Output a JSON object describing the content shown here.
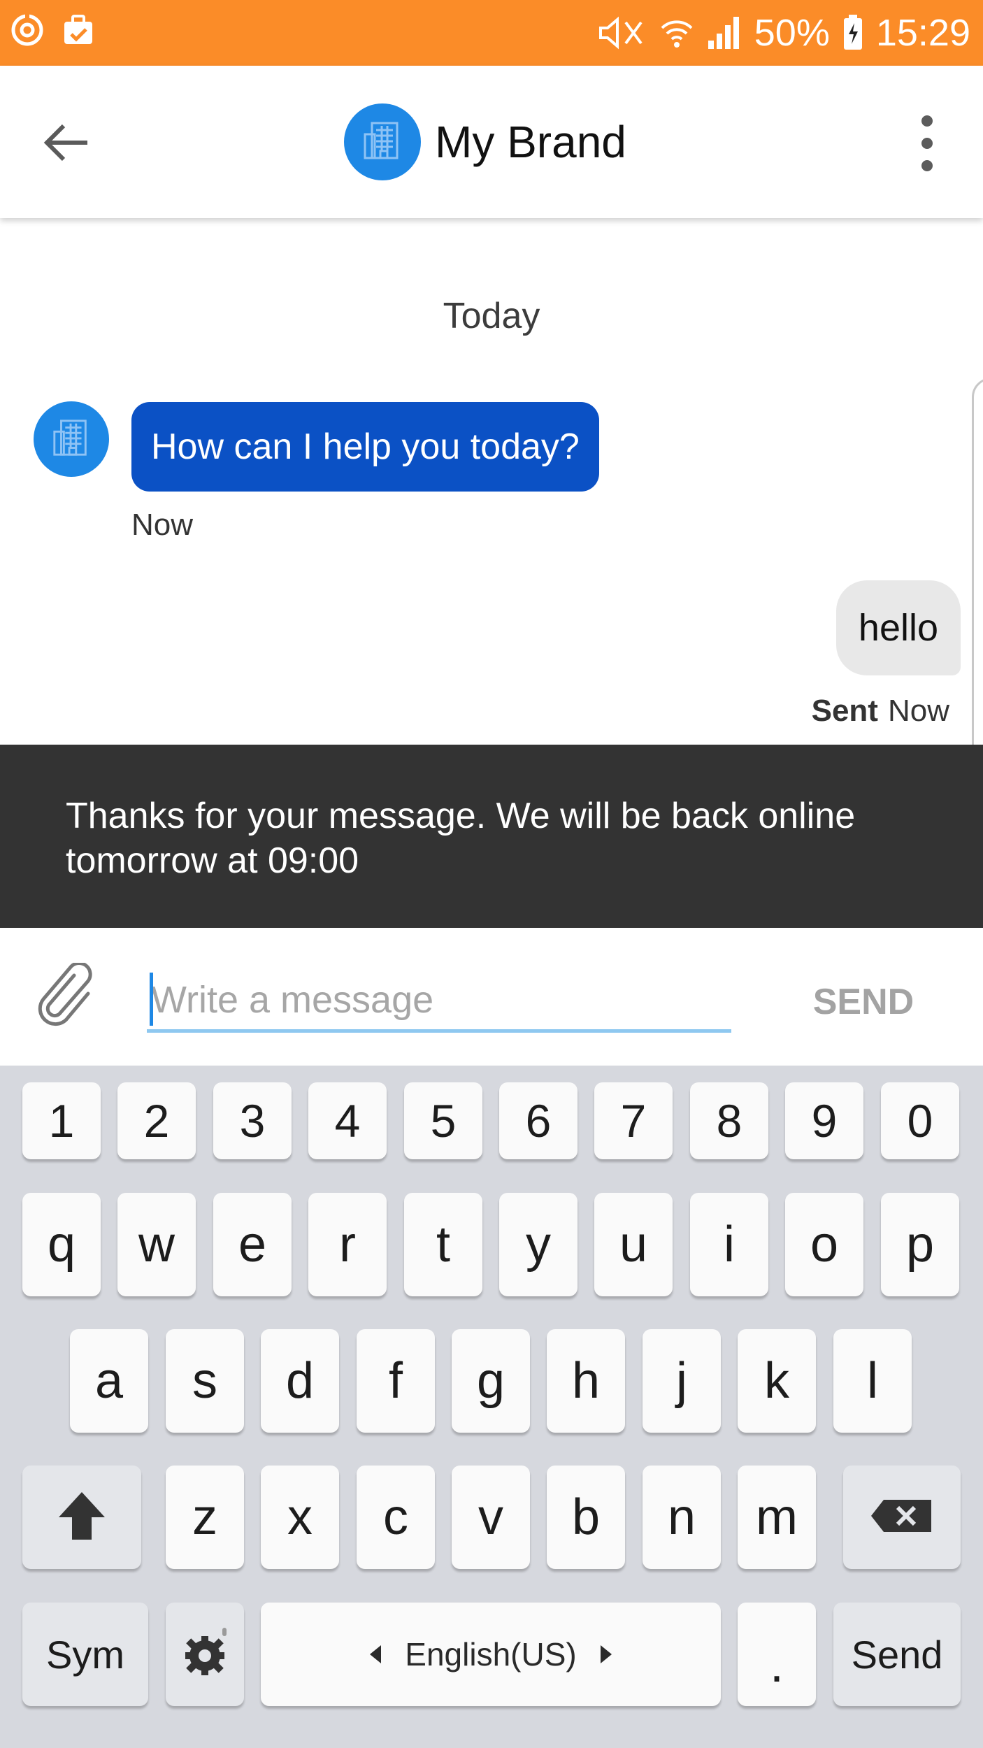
{
  "status_bar": {
    "battery": "50%",
    "time": "15:29",
    "icons": [
      "sync-icon",
      "clipboard-icon",
      "mute-icon",
      "wifi-icon",
      "signal-icon",
      "battery-charging-icon"
    ]
  },
  "header": {
    "title": "My Brand",
    "back_icon": "arrow-back-icon",
    "menu_icon": "more-vertical-icon",
    "avatar_icon": "building-icon"
  },
  "conversation": {
    "date_separator": "Today",
    "messages": [
      {
        "direction": "incoming",
        "text": "How can I help you today?",
        "time": "Now"
      },
      {
        "direction": "outgoing",
        "text": "hello",
        "status": "Sent",
        "time": "Now"
      }
    ]
  },
  "banner": {
    "text": "Thanks for your message. We will be back online tomorrow at 09:00"
  },
  "composer": {
    "placeholder": "Write a message",
    "value": "",
    "send_label": "SEND",
    "attach_icon": "paperclip-icon"
  },
  "keyboard": {
    "number_row": [
      "1",
      "2",
      "3",
      "4",
      "5",
      "6",
      "7",
      "8",
      "9",
      "0"
    ],
    "row1": [
      "q",
      "w",
      "e",
      "r",
      "t",
      "y",
      "u",
      "i",
      "o",
      "p"
    ],
    "row2": [
      "a",
      "s",
      "d",
      "f",
      "g",
      "h",
      "j",
      "k",
      "l"
    ],
    "row3": [
      "z",
      "x",
      "c",
      "v",
      "b",
      "n",
      "m"
    ],
    "sym_label": "Sym",
    "space_label": "English(US)",
    "period_label": ".",
    "send_label": "Send"
  },
  "colors": {
    "status_bar": "#fb8c28",
    "brand_avatar": "#1e88e5",
    "incoming_bubble": "#0b51c5",
    "outgoing_bubble": "#e8e8e8",
    "banner": "#333333",
    "keyboard_bg": "#d6d8de"
  }
}
